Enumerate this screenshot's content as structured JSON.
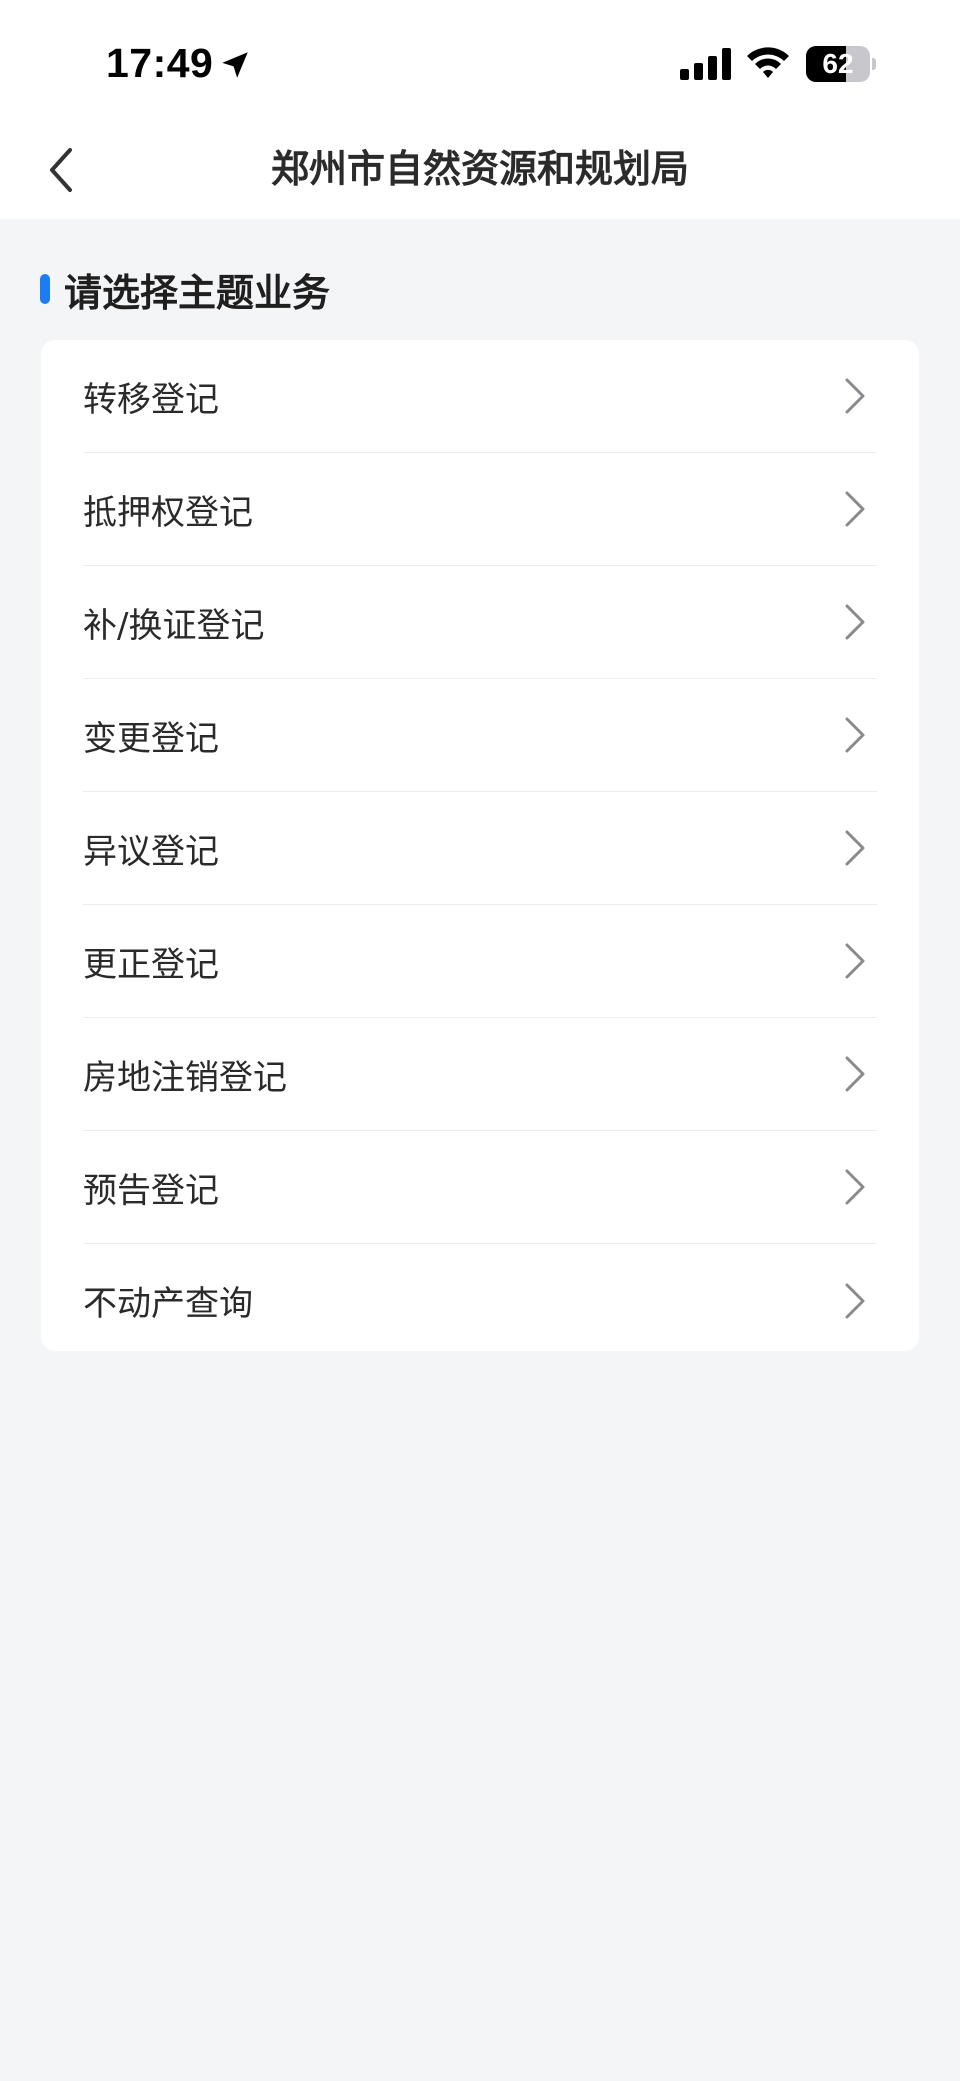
{
  "status_bar": {
    "time": "17:49",
    "battery_level": 62,
    "battery_text": "62",
    "icons": [
      "location-arrow-icon",
      "cellular-signal-icon",
      "wifi-icon",
      "battery-icon"
    ]
  },
  "nav": {
    "title": "郑州市自然资源和规划局",
    "back_icon": "chevron-left-icon"
  },
  "section": {
    "title": "请选择主题业务",
    "accent_color": "#1e7cf2"
  },
  "menu": {
    "items": [
      {
        "label": "转移登记"
      },
      {
        "label": "抵押权登记"
      },
      {
        "label": "补/换证登记"
      },
      {
        "label": "变更登记"
      },
      {
        "label": "异议登记"
      },
      {
        "label": "更正登记"
      },
      {
        "label": "房地注销登记"
      },
      {
        "label": "预告登记"
      },
      {
        "label": "不动产查询"
      }
    ],
    "chevron_icon": "chevron-right-icon"
  },
  "colors": {
    "background": "#f4f5f7",
    "card": "#ffffff",
    "accent": "#1e7cf2"
  }
}
